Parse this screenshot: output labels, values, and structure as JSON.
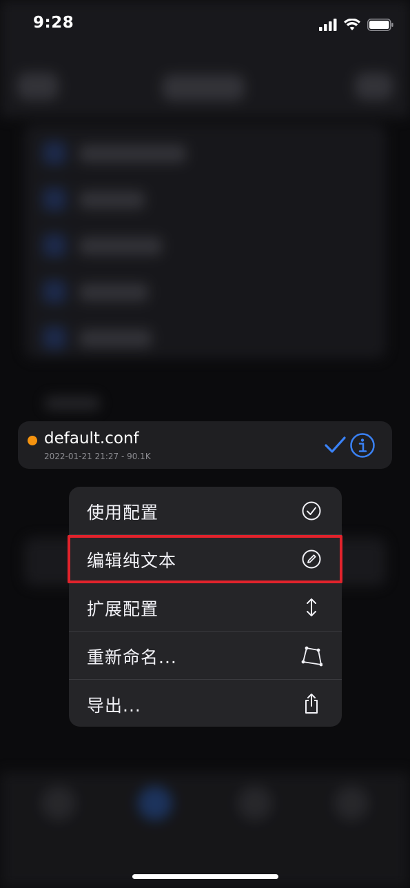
{
  "status_bar": {
    "time": "9:28"
  },
  "preview": {
    "file_name": "default.conf",
    "file_meta": "2022-01-21 21:27 - 90.1K",
    "status_color": "#f5930f"
  },
  "menu": {
    "items": [
      {
        "label": "使用配置",
        "icon": "checkmark-circle-icon"
      },
      {
        "label": "编辑纯文本",
        "icon": "pencil-circle-icon"
      },
      {
        "label": "扩展配置",
        "icon": "expand-arrows-icon"
      },
      {
        "label": "重新命名...",
        "icon": "rename-polygon-icon"
      },
      {
        "label": "导出...",
        "icon": "share-icon"
      }
    ]
  },
  "colors": {
    "accent": "#3a82f7",
    "highlight": "#e1232c"
  }
}
